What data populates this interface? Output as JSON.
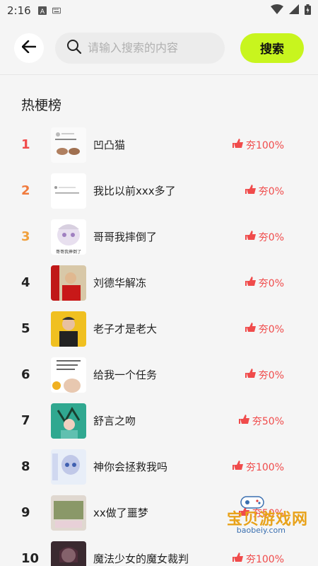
{
  "status": {
    "time": "2:16"
  },
  "search": {
    "placeholder": "请输入搜索的内容",
    "button_label": "搜索"
  },
  "section": {
    "title": "热梗榜"
  },
  "items": [
    {
      "rank": "1",
      "title": "凹凸猫",
      "praise": "夯100%"
    },
    {
      "rank": "2",
      "title": "我比以前xxx多了",
      "praise": "夯0%"
    },
    {
      "rank": "3",
      "title": "哥哥我摔倒了",
      "praise": "夯0%"
    },
    {
      "rank": "4",
      "title": "刘德华解冻",
      "praise": "夯0%"
    },
    {
      "rank": "5",
      "title": "老子才是老大",
      "praise": "夯0%"
    },
    {
      "rank": "6",
      "title": "给我一个任务",
      "praise": "夯0%"
    },
    {
      "rank": "7",
      "title": "舒言之吻",
      "praise": "夯50%"
    },
    {
      "rank": "8",
      "title": "神你会拯救我吗",
      "praise": "夯100%"
    },
    {
      "rank": "9",
      "title": "xx做了噩梦",
      "praise": "夯50%"
    },
    {
      "rank": "10",
      "title": "魔法少女的魔女裁判",
      "praise": "夯100%"
    }
  ],
  "thumb_captions": {
    "t3": "哥哥我摔倒了"
  },
  "watermark": {
    "name": "宝贝游戏网",
    "url": "baobeiy.com"
  },
  "colors": {
    "accent": "#c8f51e",
    "praise": "#f04b4b",
    "rank1": "#f04b4b",
    "rank2": "#f07a3c",
    "rank3": "#f0a03c"
  }
}
